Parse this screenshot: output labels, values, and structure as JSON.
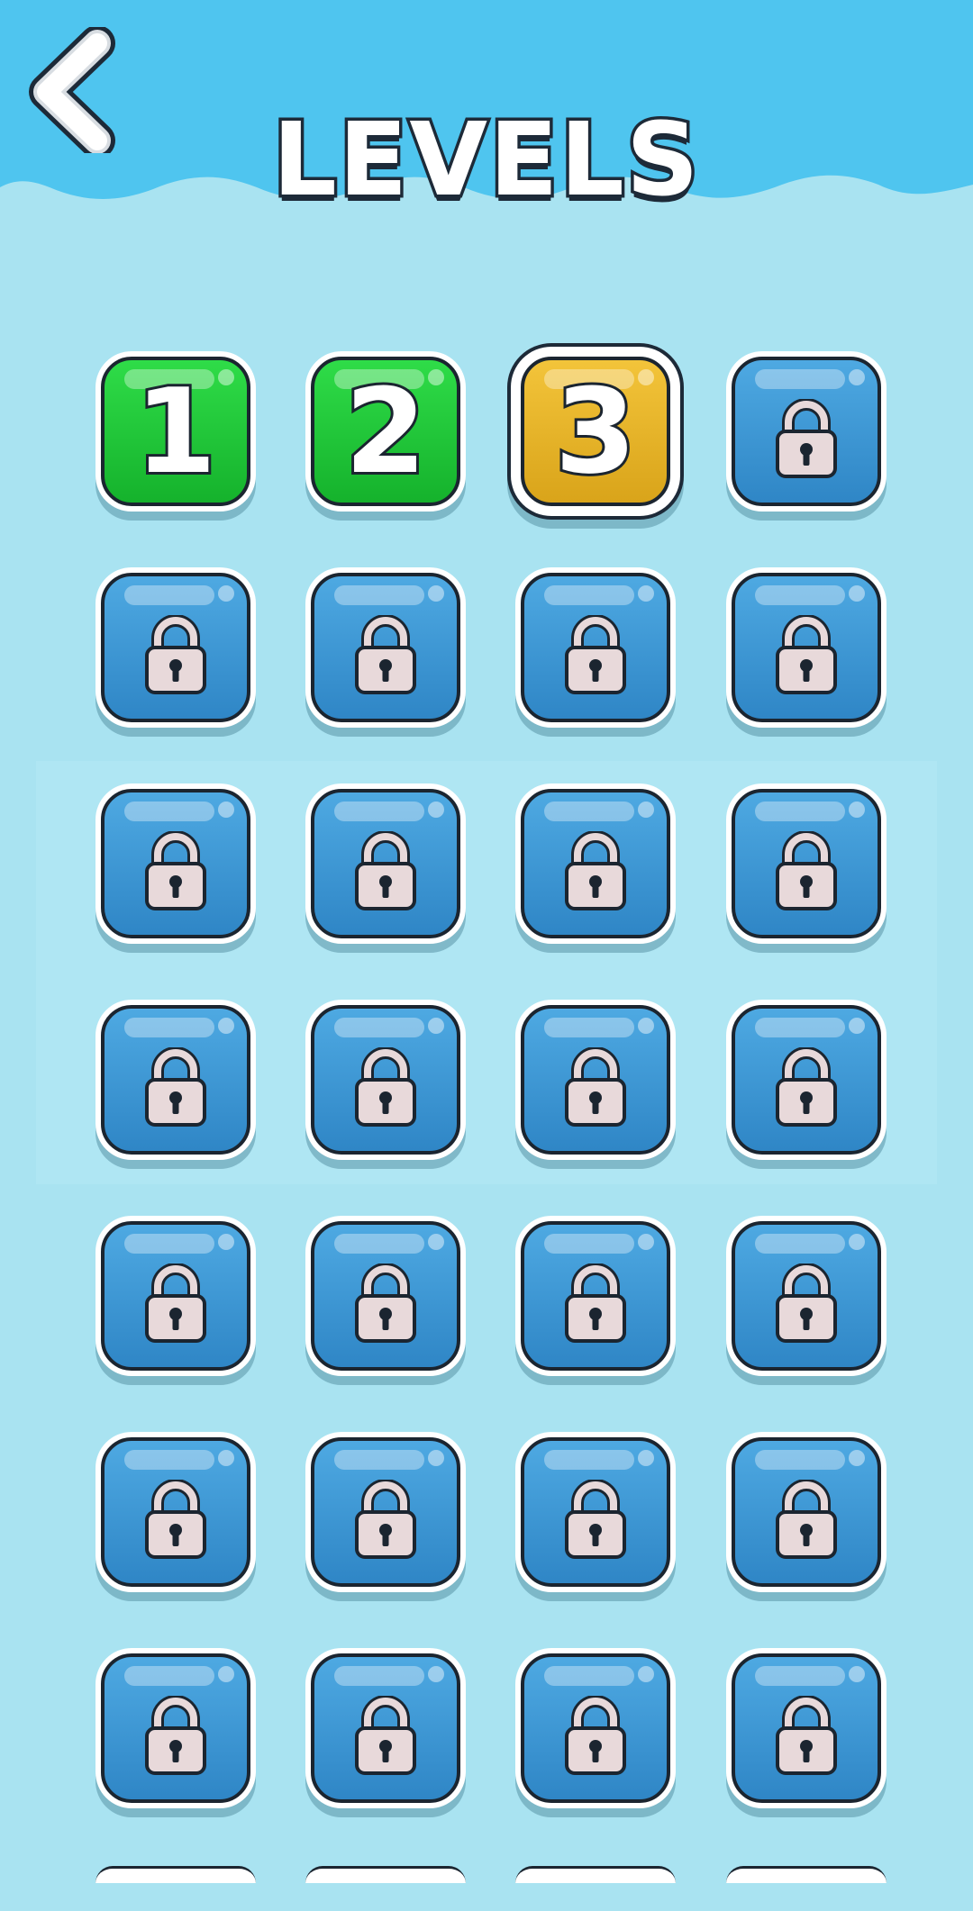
{
  "header": {
    "title": "LEVELS",
    "back_icon": "chevron-left-icon",
    "colors": {
      "sky": "#4fc5ef",
      "wave": "#a9e3f1",
      "title_fill": "#ffffff",
      "title_outline": "#1d2a38"
    }
  },
  "levels": [
    {
      "label": "1",
      "state": "completed",
      "color": "#22c93b"
    },
    {
      "label": "2",
      "state": "completed",
      "color": "#22c93b"
    },
    {
      "label": "3",
      "state": "current",
      "color": "#e6b32a"
    },
    {
      "label": "",
      "state": "locked",
      "color": "#3a93d2",
      "icon": "lock-icon"
    }
  ],
  "locked_rows_visible": 6,
  "lock_icon": "lock-icon",
  "colors": {
    "background": "#a9e3f1",
    "locked": "#3a93d2",
    "completed": "#22c93b",
    "current": "#e6b32a"
  }
}
